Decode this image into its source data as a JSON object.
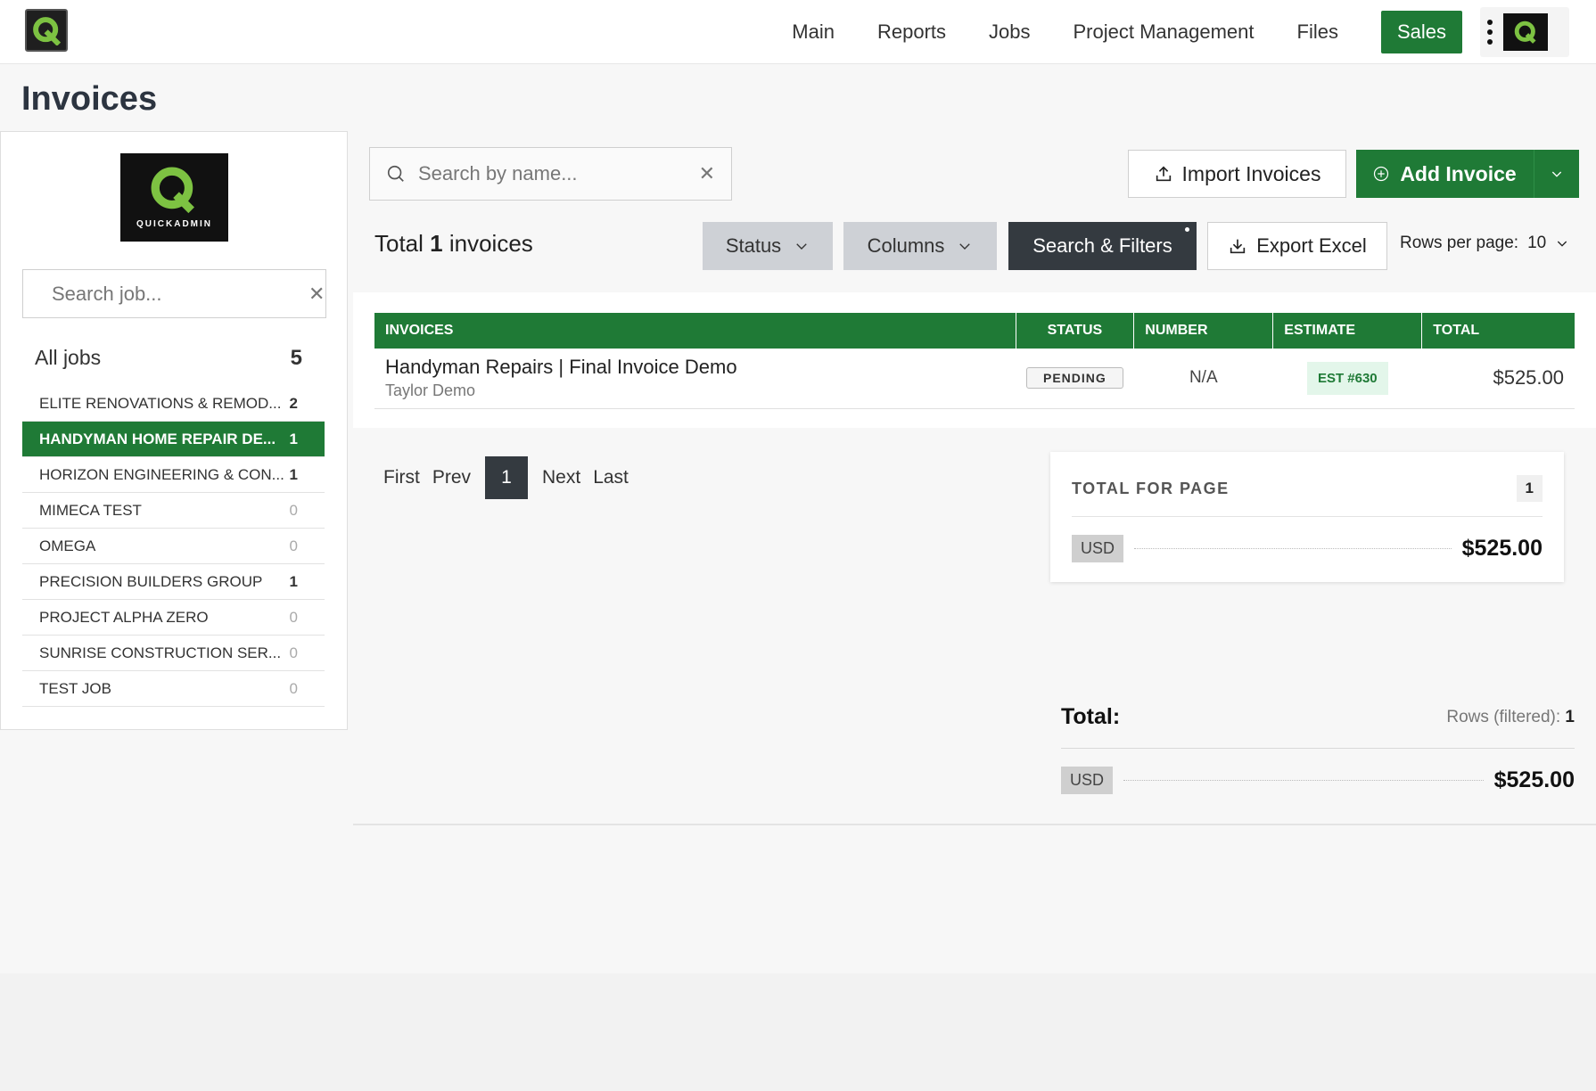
{
  "nav": {
    "items": [
      "Main",
      "Reports",
      "Jobs",
      "Project Management",
      "Files"
    ],
    "sales": "Sales"
  },
  "page": {
    "title": "Invoices"
  },
  "brand": {
    "name": "QUICKADMIN"
  },
  "sidebar": {
    "search_placeholder": "Search job...",
    "all_jobs_label": "All jobs",
    "all_jobs_count": "5",
    "jobs": [
      {
        "name": "ELITE RENOVATIONS & REMOD...",
        "count": "2"
      },
      {
        "name": "HANDYMAN HOME REPAIR DE...",
        "count": "1"
      },
      {
        "name": "HORIZON ENGINEERING & CON...",
        "count": "1"
      },
      {
        "name": "MIMECA TEST",
        "count": "0"
      },
      {
        "name": "OMEGA",
        "count": "0"
      },
      {
        "name": "PRECISION BUILDERS GROUP",
        "count": "1"
      },
      {
        "name": "PROJECT ALPHA ZERO",
        "count": "0"
      },
      {
        "name": "SUNRISE CONSTRUCTION SER...",
        "count": "0"
      },
      {
        "name": "TEST JOB",
        "count": "0"
      }
    ],
    "active_index": 1
  },
  "toolbar": {
    "search_placeholder": "Search by name...",
    "import_label": "Import Invoices",
    "add_label": "Add Invoice",
    "total_prefix": "Total",
    "total_count": "1",
    "total_suffix": "invoices",
    "status_label": "Status",
    "columns_label": "Columns",
    "filters_label": "Search & Filters",
    "export_label": "Export Excel",
    "rows_per_page_label": "Rows per page:",
    "rows_per_page_value": "10"
  },
  "table": {
    "headers": [
      "INVOICES",
      "STATUS",
      "NUMBER",
      "ESTIMATE",
      "TOTAL"
    ],
    "rows": [
      {
        "name": "Handyman Repairs | Final Invoice Demo",
        "client": "Taylor Demo",
        "status": "PENDING",
        "number": "N/A",
        "estimate": "EST #630",
        "total": "$525.00"
      }
    ]
  },
  "pager": {
    "first": "First",
    "prev": "Prev",
    "current": "1",
    "next": "Next",
    "last": "Last"
  },
  "page_total": {
    "label": "TOTAL FOR PAGE",
    "count": "1",
    "currency": "USD",
    "amount": "$525.00"
  },
  "grand_total": {
    "label": "Total:",
    "rows_label": "Rows (filtered):",
    "rows_count": "1",
    "currency": "USD",
    "amount": "$525.00"
  },
  "colors": {
    "brand_green": "#1f7a36",
    "dark_button": "#343a40",
    "accent_logo": "#7dc242"
  },
  "icons": [
    "search-icon",
    "close-icon",
    "upload-icon",
    "plus-circle-icon",
    "chevron-down-icon",
    "download-icon",
    "more-vertical-icon"
  ]
}
